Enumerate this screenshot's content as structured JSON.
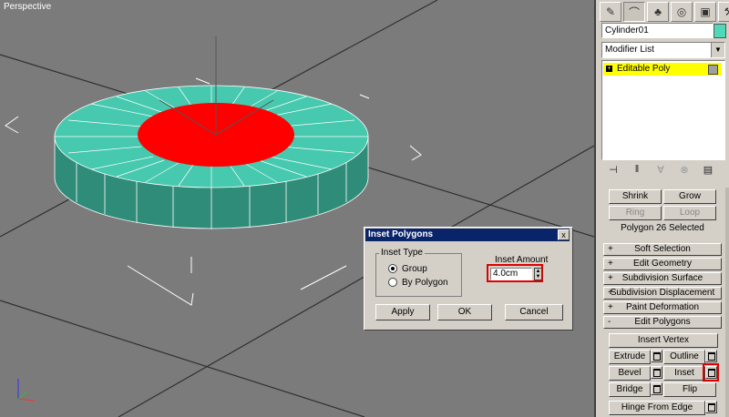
{
  "viewport": {
    "label": "Perspective"
  },
  "colors": {
    "cylinder_side": "#2f8c79",
    "cylinder_top": "#46c9ae",
    "selected_poly": "#ff0000",
    "viewport_bg": "#7b7b7b"
  },
  "command_panel": {
    "tabs": [
      "create-icon",
      "modify-icon",
      "hierarchy-icon",
      "motion-icon",
      "display-icon",
      "utilities-icon"
    ],
    "object_name": "Cylinder01",
    "modifier_list": "Modifier List",
    "stack_item": "Editable Poly",
    "shrink": "Shrink",
    "grow": "Grow",
    "ring": "Ring",
    "loop": "Loop",
    "selection_status": "Polygon 26 Selected",
    "rollouts": {
      "soft_selection": "Soft Selection",
      "edit_geometry": "Edit Geometry",
      "subdivision_surface": "Subdivision Surface",
      "subdivision_displacement": "Subdivision Displacement",
      "paint_deformation": "Paint Deformation",
      "edit_polygons": "Edit Polygons"
    },
    "plus": "+",
    "minus": "-",
    "buttons": {
      "insert_vertex": "Insert Vertex",
      "extrude": "Extrude",
      "outline": "Outline",
      "bevel": "Bevel",
      "inset": "Inset",
      "bridge": "Bridge",
      "flip": "Flip",
      "hinge_from_edge": "Hinge From Edge"
    }
  },
  "dialog": {
    "title": "Inset Polygons",
    "close": "x",
    "inset_type_label": "Inset Type",
    "options": [
      "Group",
      "By Polygon"
    ],
    "selected_option": "Group",
    "inset_amount_label": "Inset Amount",
    "inset_amount_value": "4.0cm",
    "apply": "Apply",
    "ok": "OK",
    "cancel": "Cancel"
  }
}
